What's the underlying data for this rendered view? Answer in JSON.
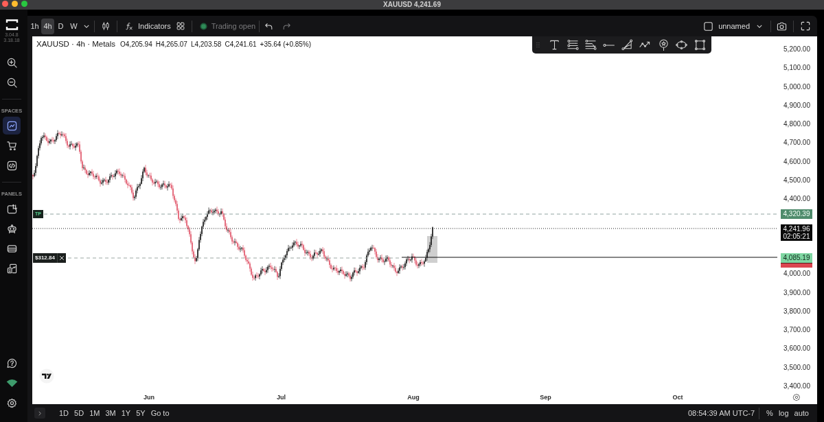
{
  "window": {
    "title": "XAUUSD 4,241.69"
  },
  "sidebar": {
    "versions": [
      "3.04.8",
      "3.18.18"
    ],
    "spaces": {
      "heading": "SPACES",
      "items": [
        {
          "selected": true
        },
        {
          "selected": false
        },
        {
          "selected": false
        }
      ]
    },
    "panels": {
      "heading": "PANELS"
    }
  },
  "toolbar": {
    "intervals": [
      {
        "label": "1h",
        "selected": false
      },
      {
        "label": "4h",
        "selected": true
      },
      {
        "label": "D",
        "selected": false
      },
      {
        "label": "W",
        "selected": false
      }
    ],
    "indicators": "Indicators",
    "trading_status": {
      "label": "Trading open",
      "disabled": true
    },
    "undo": {
      "disabled": false
    },
    "redo": {
      "disabled": true
    },
    "layout_name": "unnamed"
  },
  "legend": {
    "symbol": "XAUUSD · 4h · Metals",
    "ohlc": [
      "O4,205.94",
      "H4,265.07",
      "L4,203.58",
      "C4,241.61"
    ],
    "change": "+35.64 (+0.85%)"
  },
  "price_axis": {
    "labels": [
      "5,200.00",
      "5,100.00",
      "5,000.00",
      "4,900.00",
      "4,800.00",
      "4,700.00",
      "4,600.00",
      "4,500.00",
      "4,400.00",
      "4,000.00",
      "3,900.00",
      "3,800.00",
      "3,700.00",
      "3,600.00",
      "3,500.00",
      "3,400.00"
    ]
  },
  "price_markers": [
    {
      "kind": "take_profit",
      "tag": "TP",
      "price": "4,320.39"
    },
    {
      "kind": "last",
      "price": "4,241.96",
      "countdown": "02:05:21"
    },
    {
      "kind": "entry",
      "tag": "$312.84",
      "price": "4,085.19"
    }
  ],
  "time_axis": {
    "labels": [
      "Jun",
      "Jul",
      "Aug",
      "Sep",
      "Oct"
    ]
  },
  "bottom_bar": {
    "ranges": [
      "1D",
      "5D",
      "1M",
      "3M",
      "1Y",
      "5Y"
    ],
    "go_to": "Go to",
    "clock": "08:54:39 AM UTC-7",
    "scale_options": [
      "%",
      "log",
      "auto"
    ]
  }
}
